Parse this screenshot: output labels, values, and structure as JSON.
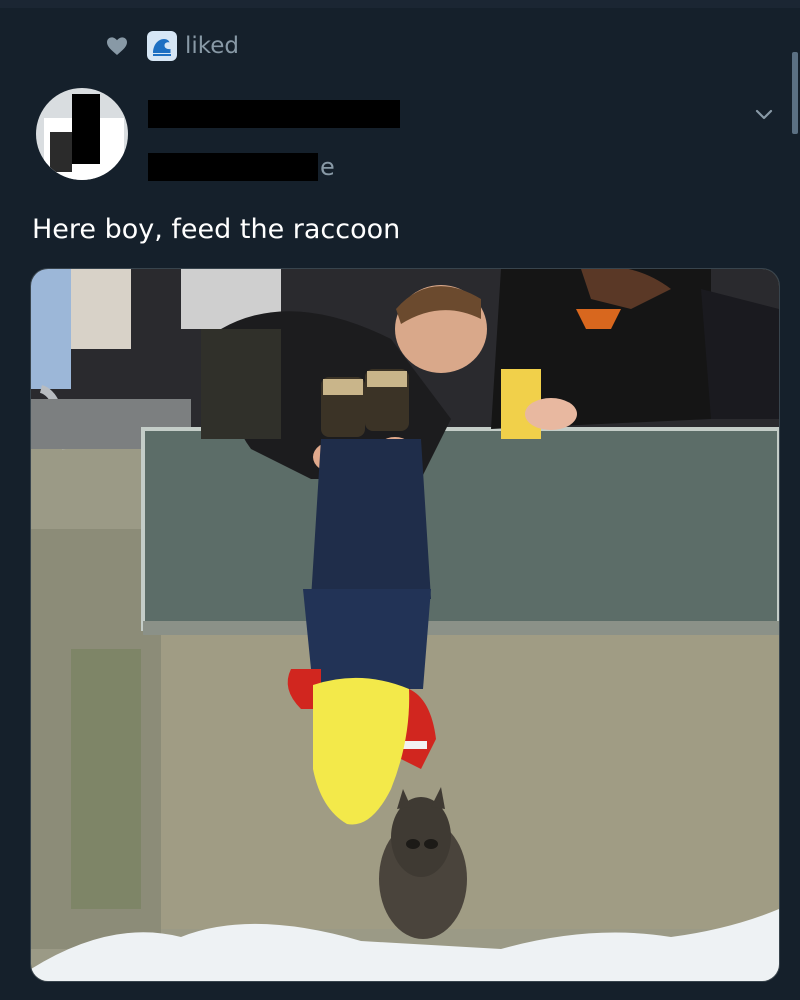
{
  "activity": {
    "liked_text": "liked",
    "icons": [
      "heart-icon",
      "wave-icon"
    ]
  },
  "user": {
    "display_name": "",
    "handle_visible_suffix": "e",
    "avatar": "redacted profile photo"
  },
  "tweet": {
    "text": "Here boy, feed the raccoon",
    "photo_icon": "photo"
  },
  "colors": {
    "background": "#15202b",
    "secondary_text": "#8899a6",
    "primary_text": "#ffffff",
    "redaction": "#000000"
  }
}
